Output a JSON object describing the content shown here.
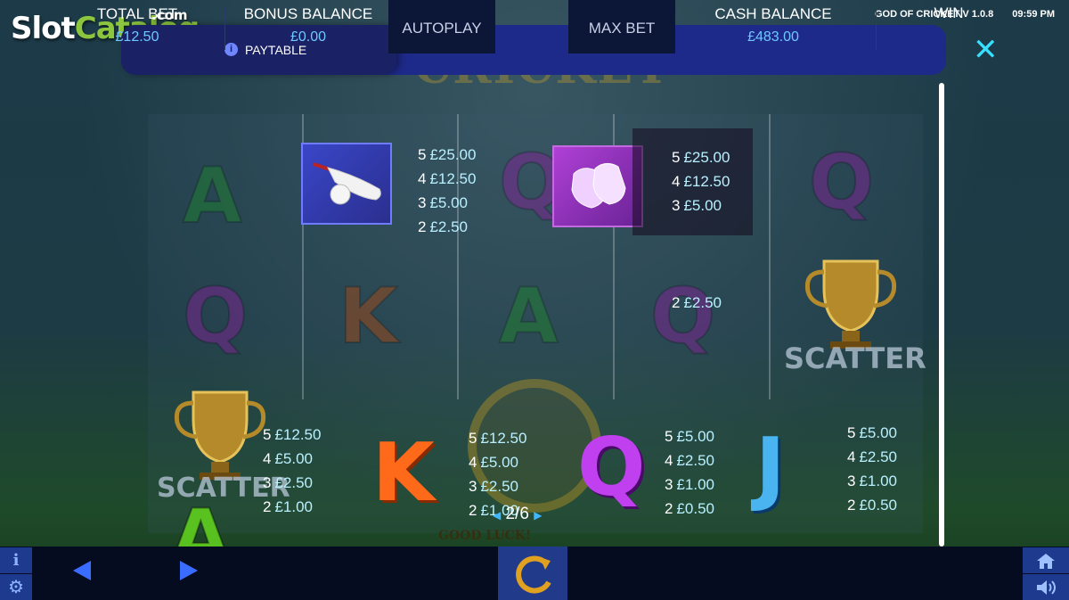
{
  "brand": {
    "slot": "Slot",
    "catalog": "Catalog",
    "com": ".com"
  },
  "top_info": {
    "game_version": "GOD OF CRICKET  V 1.0.8",
    "time": "09:59 PM"
  },
  "header": {
    "tab_label": "PAYTABLE",
    "close_label": "X"
  },
  "background": {
    "logo_text": "CRICKET"
  },
  "paytable": {
    "bat": [
      {
        "count": "5",
        "amount": "£25.00"
      },
      {
        "count": "4",
        "amount": "£12.50"
      },
      {
        "count": "3",
        "amount": "£5.00"
      },
      {
        "count": "2",
        "amount": "£2.50"
      }
    ],
    "gloves": [
      {
        "count": "5",
        "amount": "£25.00"
      },
      {
        "count": "4",
        "amount": "£12.50"
      },
      {
        "count": "3",
        "amount": "£5.00"
      }
    ],
    "gloves_extra": {
      "count": "2",
      "amount": "£2.50"
    },
    "scatter": {
      "label": "SCATTER",
      "rows": [
        {
          "count": "5",
          "amount": "£12.50"
        },
        {
          "count": "4",
          "amount": "£5.00"
        },
        {
          "count": "3",
          "amount": "£2.50"
        },
        {
          "count": "2",
          "amount": "£1.00"
        }
      ]
    },
    "k": {
      "symbol": "K",
      "rows": [
        {
          "count": "5",
          "amount": "£12.50"
        },
        {
          "count": "4",
          "amount": "£5.00"
        },
        {
          "count": "3",
          "amount": "£2.50"
        },
        {
          "count": "2",
          "amount": "£1.00"
        }
      ]
    },
    "q": {
      "symbol": "Q",
      "rows": [
        {
          "count": "5",
          "amount": "£5.00"
        },
        {
          "count": "4",
          "amount": "£2.50"
        },
        {
          "count": "3",
          "amount": "£1.00"
        },
        {
          "count": "2",
          "amount": "£0.50"
        }
      ]
    },
    "j": {
      "symbol": "J",
      "rows": [
        {
          "count": "5",
          "amount": "£5.00"
        },
        {
          "count": "4",
          "amount": "£2.50"
        },
        {
          "count": "3",
          "amount": "£1.00"
        },
        {
          "count": "2",
          "amount": "£0.50"
        }
      ]
    }
  },
  "page": {
    "indicator": "2/6"
  },
  "good_luck": "GOOD LUCK!",
  "bottom_bar": {
    "total_bet_label": "TOTAL BET",
    "total_bet_value": "£12.50",
    "bonus_balance_label": "BONUS BALANCE",
    "bonus_balance_value": "£0.00",
    "autoplay_label": "AUTOPLAY",
    "max_bet_label": "MAX BET",
    "cash_balance_label": "CASH BALANCE",
    "cash_balance_value": "£483.00",
    "win_label": "WIN"
  },
  "colors": {
    "accent": "#38dfff",
    "bar": "#1e2a8a",
    "tab": "#1a2164",
    "value_text": "#6fc8ff"
  }
}
